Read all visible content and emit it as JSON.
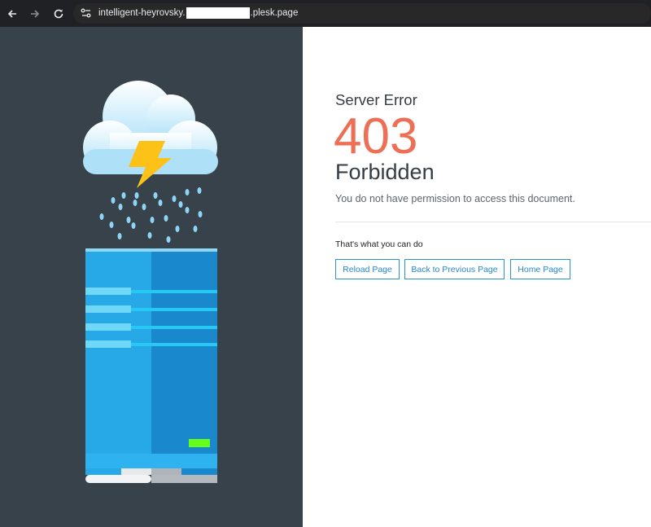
{
  "browser": {
    "url_prefix": "intelligent-heyrovsky.",
    "url_suffix": ".plesk.page",
    "icons": [
      "back-arrow-icon",
      "forward-arrow-icon",
      "reload-icon",
      "site-settings-icon"
    ]
  },
  "error": {
    "eyebrow": "Server Error",
    "code": "403",
    "title": "Forbidden",
    "description": "You do not have permission to access this document."
  },
  "actions": {
    "heading": "That's what you can do",
    "buttons": [
      "Reload Page",
      "Back to Previous Page",
      "Home Page"
    ]
  },
  "colors": {
    "accent": "#ec6f56",
    "button": "#2b94d4",
    "panel": "#37424b"
  }
}
